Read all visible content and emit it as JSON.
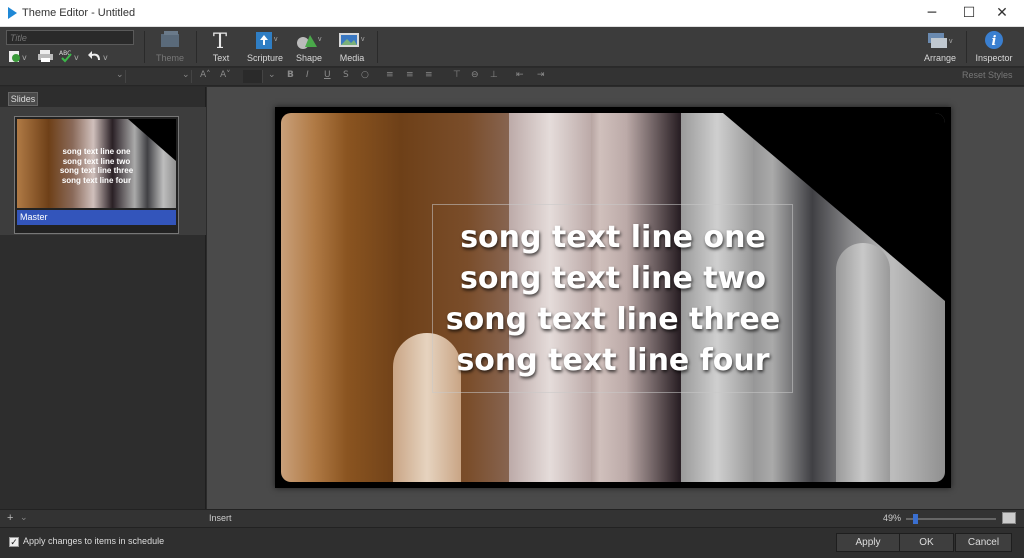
{
  "window": {
    "title": "Theme Editor - Untitled",
    "minimize": "─",
    "maximize": "☐",
    "close": "✕"
  },
  "toolbar": {
    "title_placeholder": "Title",
    "theme_label": "Theme",
    "text_label": "Text",
    "scripture_label": "Scripture",
    "shape_label": "Shape",
    "media_label": "Media",
    "arrange_label": "Arrange",
    "inspector_label": "Inspector"
  },
  "formatbar": {
    "bold": "B",
    "italic": "I",
    "underline": "U",
    "strike": "S",
    "reset_styles": "Reset Styles"
  },
  "sidebar": {
    "tab": "Slides",
    "slide_caption": "Master"
  },
  "slide": {
    "lines": [
      "song text line one",
      "song text line two",
      "song text line three",
      "song text line four"
    ]
  },
  "statusbar": {
    "add": "+",
    "insert": "Insert",
    "zoom": "49%",
    "zoom_fraction": 0.08
  },
  "bottom": {
    "apply_changes": "Apply changes to items in schedule",
    "apply": "Apply",
    "ok": "OK",
    "cancel": "Cancel"
  },
  "colors": {
    "accent": "#3355bb",
    "app_icon": "#1f88d6"
  }
}
